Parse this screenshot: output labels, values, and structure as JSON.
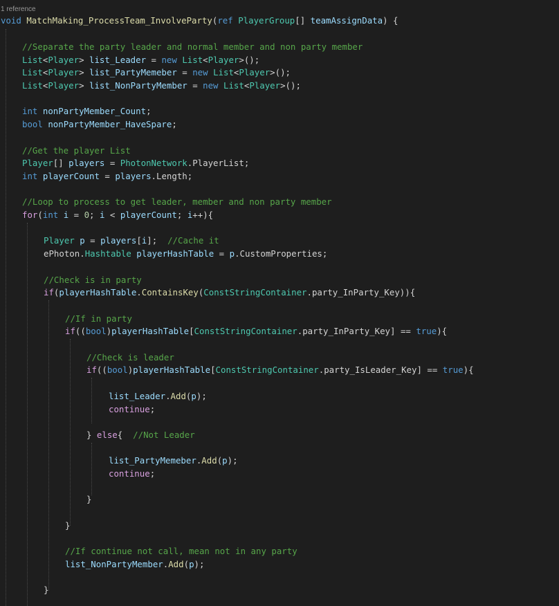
{
  "codelens": {
    "references": "1 reference"
  },
  "code": {
    "signature": {
      "void": "void",
      "method": "MatchMaking_ProcessTeam_InvolveParty",
      "open": "(",
      "ref": "ref",
      "param_type": "PlayerGroup",
      "brackets": "[] ",
      "param_name": "teamAssignData",
      "close": ") {"
    },
    "comment_separate": "//Separate the party leader and normal member and non party member",
    "list_type": "List",
    "player_type": "Player",
    "new_kw": "new",
    "list_leader": "list_Leader",
    "list_party": "list_PartyMemeber",
    "list_nonparty": "list_NonPartyMember",
    "int_kw": "int",
    "bool_kw": "bool",
    "nonparty_count": "nonPartyMember_Count",
    "nonparty_spare": "nonPartyMember_HaveSpare",
    "comment_getlist": "//Get the player List",
    "players_var": "players",
    "photon_network": "PhotonNetwork",
    "player_list_prop": "PlayerList",
    "player_count": "playerCount",
    "length_prop": "Length",
    "comment_loop": "//Loop to process to get leader, member and non party member",
    "for_kw": "for",
    "i_var": "i",
    "zero": "0",
    "p_var": "p",
    "comment_cache": "//Cache it",
    "ephoton": "ePhoton",
    "hashtable": "Hashtable",
    "hash_var": "playerHashTable",
    "custom_props": "CustomProperties",
    "comment_check_party": "//Check is in party",
    "if_kw": "if",
    "contains_key": "ContainsKey",
    "const_container": "ConstStringContainer",
    "party_key": "party_InParty_Key",
    "leader_key": "party_IsLeader_Key",
    "comment_if_party": "//If in party",
    "true_kw": "true",
    "comment_check_leader": "//Check is leader",
    "add_fn": "Add",
    "continue_kw": "continue",
    "else_kw": "else",
    "comment_not_leader": "//Not Leader",
    "comment_if_continue": "//If continue not call, mean not in any party"
  },
  "colors": {
    "background": "#1e1e1e",
    "keyword": "#569cd6",
    "control": "#d8a0df",
    "type": "#4ec9b0",
    "function": "#dcdcaa",
    "variable": "#9cdcfe",
    "comment": "#57a64a"
  }
}
